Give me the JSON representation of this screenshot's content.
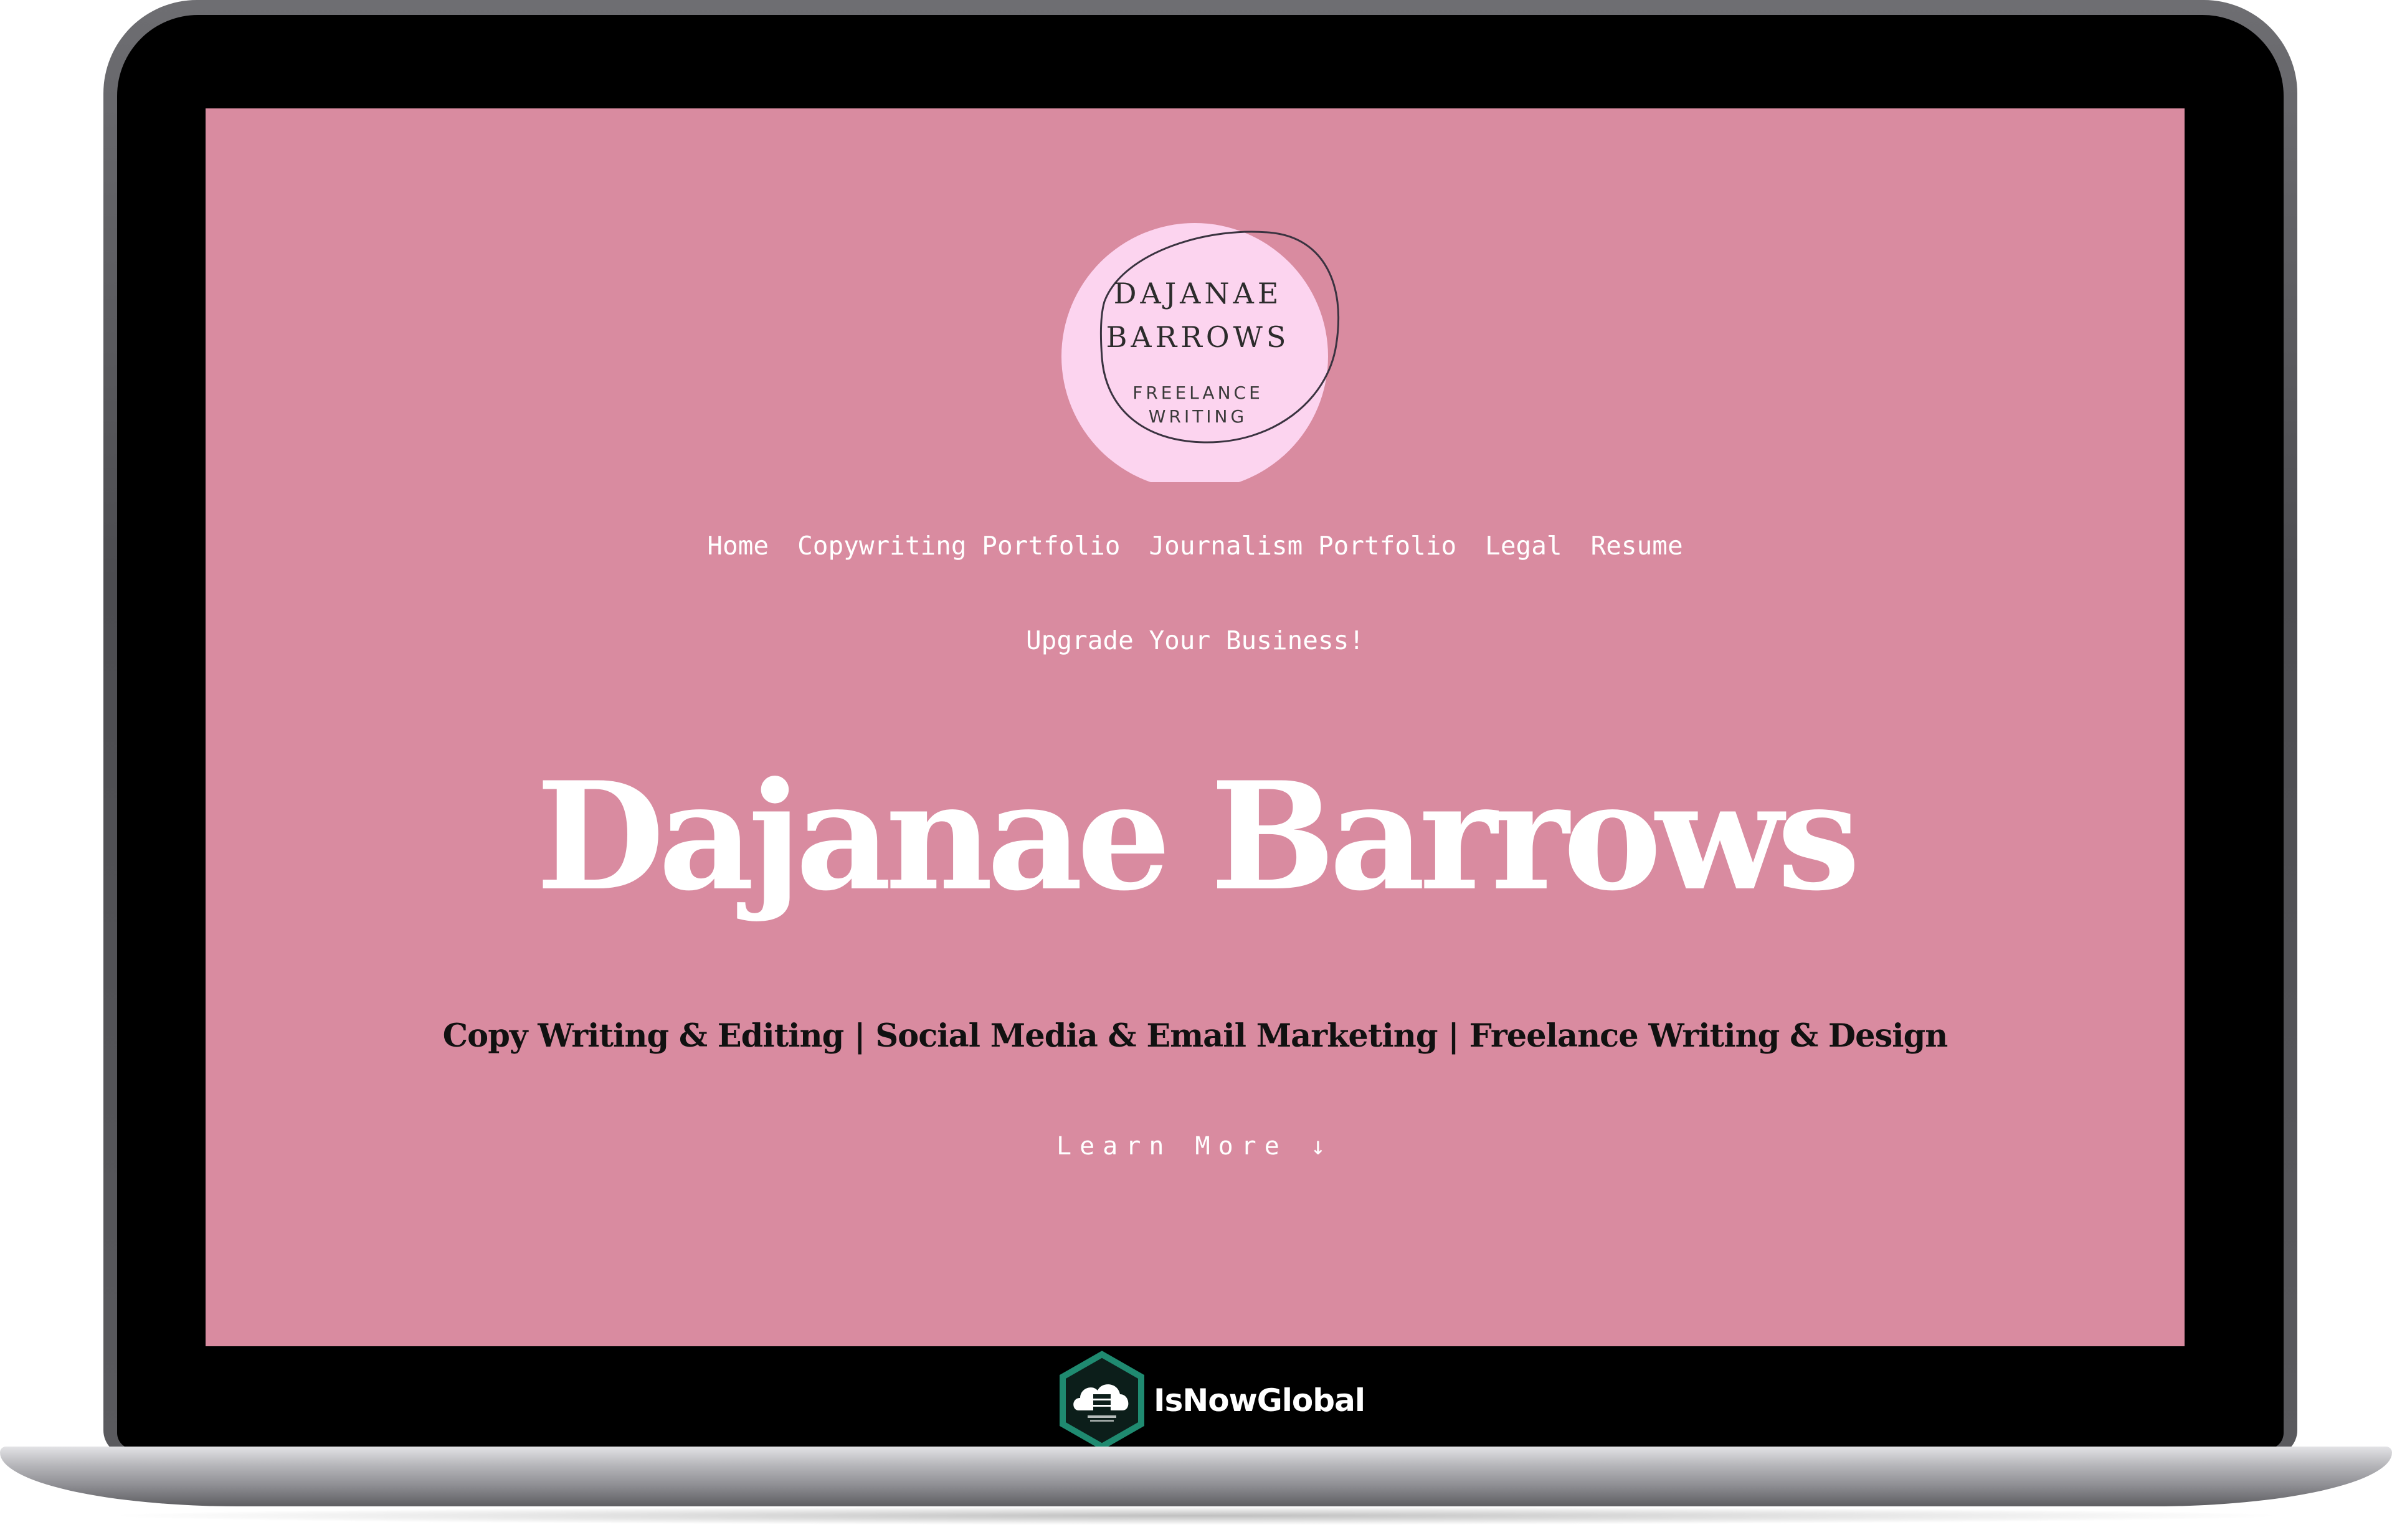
{
  "logo": {
    "name_line1": "DAJANAE",
    "name_line2": "BARROWS",
    "sub_line1": "FREELANCE",
    "sub_line2": "WRITING"
  },
  "nav": {
    "items": [
      {
        "label": "Home"
      },
      {
        "label": "Copywriting Portfolio"
      },
      {
        "label": "Journalism Portfolio"
      },
      {
        "label": "Legal"
      },
      {
        "label": "Resume"
      }
    ],
    "second_row": "Upgrade Your Business!"
  },
  "hero": {
    "title": "Dajanae Barrows",
    "subtitle": "Copy Writing & Editing | Social Media & Email Marketing | Freelance Writing & Design",
    "cta": "Learn More ↓"
  },
  "brand": {
    "name": "IsNowGlobal"
  },
  "colors": {
    "screen_background": "#d98ba0",
    "logo_circle": "#fcd4ef",
    "brand_hexagon": "#1f8a70"
  }
}
